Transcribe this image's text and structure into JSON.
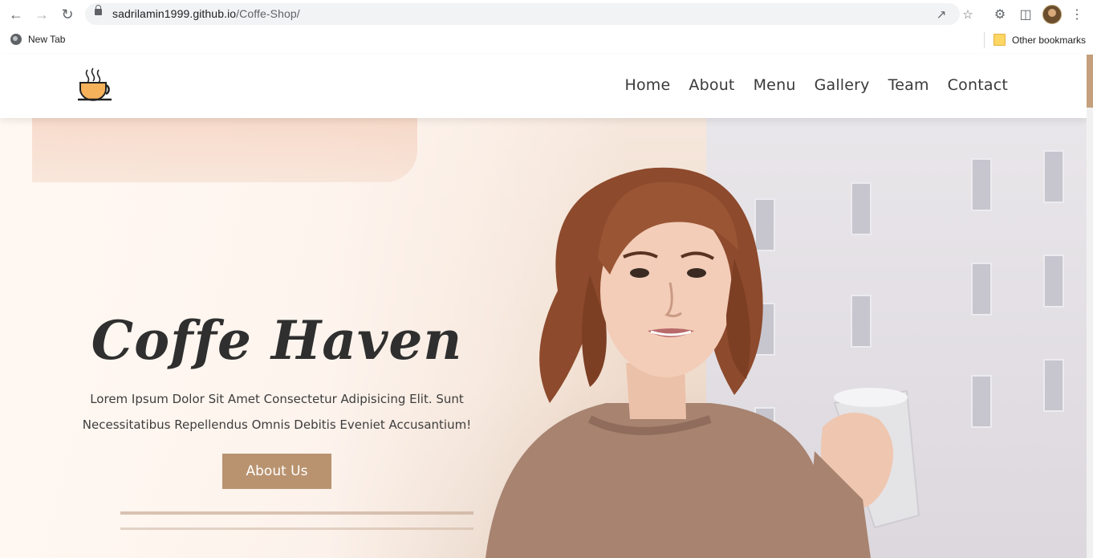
{
  "browser": {
    "url_host": "sadrilamin1999.github.io",
    "url_path": "/Coffe-Shop/",
    "bookmarks": {
      "new_tab": "New Tab",
      "other": "Other bookmarks"
    }
  },
  "site": {
    "nav": [
      "Home",
      "About",
      "Menu",
      "Gallery",
      "Team",
      "Contact"
    ],
    "hero": {
      "title": "Coffe Haven",
      "desc_line1": "Lorem Ipsum Dolor Sit Amet Consectetur Adipisicing Elit. Sunt",
      "desc_line2": "Necessitatibus Repellendus Omnis Debitis Eveniet Accusantium!",
      "button": "About Us"
    }
  },
  "colors": {
    "accent": "#b9936f",
    "logo_cup": "#f6b25b"
  }
}
